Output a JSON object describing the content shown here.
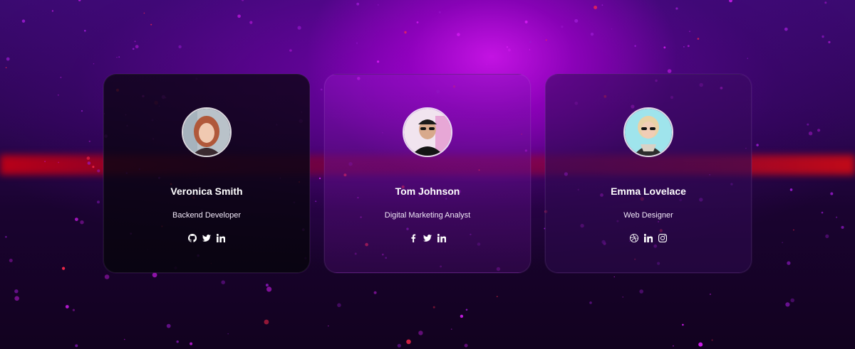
{
  "colors": {
    "accent": "#b010d8",
    "streak": "#c8001a",
    "text": "#ffffff"
  },
  "team": [
    {
      "name": "Veronica Smith",
      "role": "Backend Developer",
      "socials": [
        "github-icon",
        "twitter-icon",
        "linkedin-icon"
      ]
    },
    {
      "name": "Tom Johnson",
      "role": "Digital Marketing Analyst",
      "socials": [
        "facebook-icon",
        "twitter-icon",
        "linkedin-icon"
      ]
    },
    {
      "name": "Emma Lovelace",
      "role": "Web Designer",
      "socials": [
        "dribbble-icon",
        "linkedin-icon",
        "instagram-icon"
      ]
    }
  ]
}
